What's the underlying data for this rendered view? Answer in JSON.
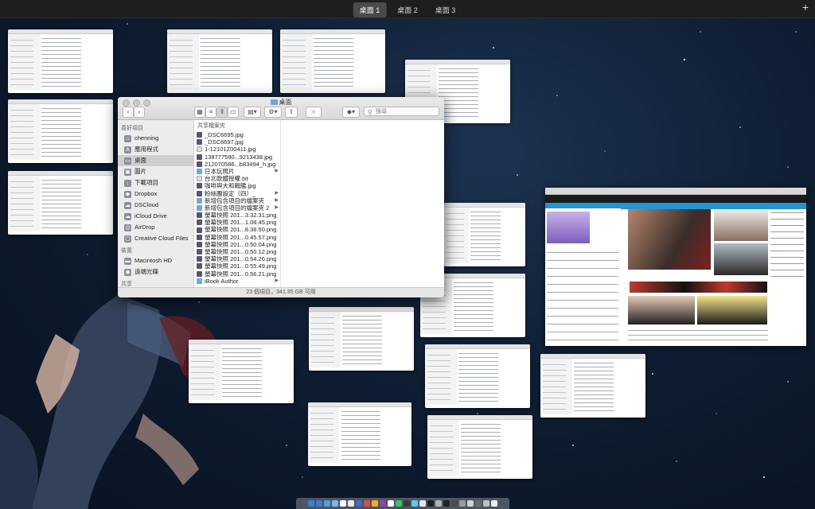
{
  "mission_control": {
    "spaces": [
      {
        "label": "桌面 1",
        "active": true
      },
      {
        "label": "桌面 2",
        "active": false
      },
      {
        "label": "桌面 3",
        "active": false
      }
    ],
    "add_space_label": "+"
  },
  "finder": {
    "title": "桌面",
    "search_placeholder": "搜尋",
    "sidebar": {
      "favorites_header": "喜好項目",
      "favorites": [
        {
          "label": "chenning",
          "icon": "home-icon"
        },
        {
          "label": "應用程式",
          "icon": "applications-icon"
        },
        {
          "label": "桌面",
          "icon": "desktop-icon",
          "selected": true
        },
        {
          "label": "圖片",
          "icon": "pictures-icon"
        },
        {
          "label": "下載項目",
          "icon": "downloads-icon"
        },
        {
          "label": "Dropbox",
          "icon": "dropbox-icon"
        },
        {
          "label": "DSCloud",
          "icon": "cloud-icon"
        },
        {
          "label": "iCloud Drive",
          "icon": "icloud-icon"
        },
        {
          "label": "AirDrop",
          "icon": "airdrop-icon"
        },
        {
          "label": "Creative Cloud Files",
          "icon": "creative-cloud-icon"
        }
      ],
      "devices_header": "裝置",
      "devices": [
        {
          "label": "Macintosh HD",
          "icon": "harddisk-icon"
        },
        {
          "label": "遠端光碟",
          "icon": "disc-icon"
        }
      ],
      "shared_header": "共享"
    },
    "column_header": "共享檔案夾",
    "files": [
      {
        "name": "_DSC6695.jpg",
        "kind": "img"
      },
      {
        "name": "_DSC6697.jpg",
        "kind": "img"
      },
      {
        "name": "1-12101Z00411.jpg",
        "kind": "txt"
      },
      {
        "name": "138777590...9213438.jpg",
        "kind": "img"
      },
      {
        "name": "212070586...b83494_h.jpg",
        "kind": "img"
      },
      {
        "name": "日本玩照片",
        "kind": "folder",
        "arrow": true
      },
      {
        "name": "台北軟體授權.txt",
        "kind": "txt"
      },
      {
        "name": "咖啡與大和戰艦.jpg",
        "kind": "img"
      },
      {
        "name": "粉絲團設定（四）_",
        "kind": "img",
        "arrow": true
      },
      {
        "name": "新增包含項目的檔案夾",
        "kind": "folder",
        "arrow": true
      },
      {
        "name": "新增包含項目的檔案夾 2",
        "kind": "folder",
        "arrow": true
      },
      {
        "name": "螢幕快照 201...3.32.31.png",
        "kind": "img"
      },
      {
        "name": "螢幕快照 201...1.08.45.png",
        "kind": "img"
      },
      {
        "name": "螢幕快照 201...8.38.50.png",
        "kind": "img"
      },
      {
        "name": "螢幕快照 201...0.45.57.png",
        "kind": "img"
      },
      {
        "name": "螢幕快照 201...0.50.04.png",
        "kind": "img"
      },
      {
        "name": "螢幕快照 201...0.50.12.png",
        "kind": "img"
      },
      {
        "name": "螢幕快照 201...0.54.26.png",
        "kind": "img"
      },
      {
        "name": "螢幕快照 201...0.55.49.png",
        "kind": "img"
      },
      {
        "name": "螢幕快照 201...0.56.21.png",
        "kind": "img"
      },
      {
        "name": "iBook Author",
        "kind": "folder",
        "arrow": true
      }
    ],
    "status": "23 個項目，341.35 GB 可用"
  }
}
